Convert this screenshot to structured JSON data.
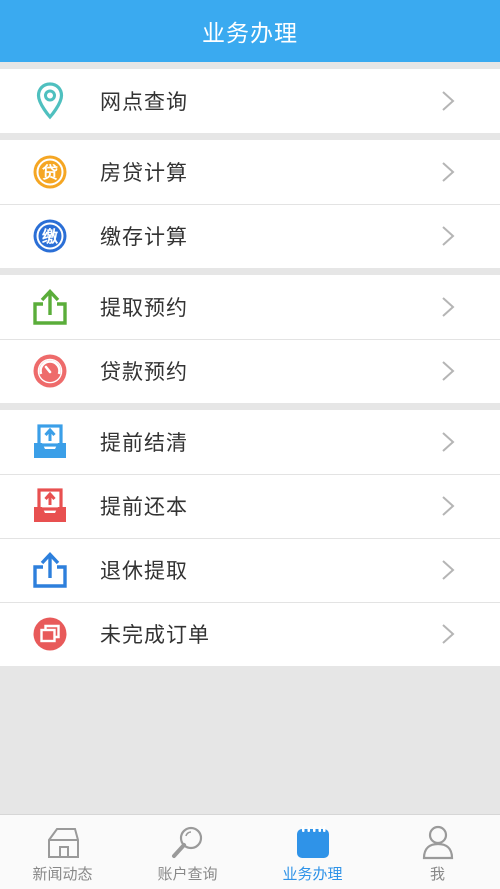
{
  "header": {
    "title": "业务办理"
  },
  "groups": [
    {
      "items": [
        {
          "label": "网点查询",
          "icon": "location-pin-icon",
          "color": "#4fc0bf"
        }
      ]
    },
    {
      "items": [
        {
          "label": "房贷计算",
          "icon": "loan-dai-icon",
          "color": "#f5a623",
          "glyph": "贷"
        },
        {
          "label": "缴存计算",
          "icon": "deposit-jiao-icon",
          "color": "#2b6fd6",
          "glyph": "缴"
        }
      ]
    },
    {
      "items": [
        {
          "label": "提取预约",
          "icon": "upload-share-icon",
          "color": "#5aad3a"
        },
        {
          "label": "贷款预约",
          "icon": "gauge-icon",
          "color": "#ee6b6b"
        }
      ]
    },
    {
      "items": [
        {
          "label": "提前结清",
          "icon": "tray-upload-icon",
          "color": "#3b9fe8"
        },
        {
          "label": "提前还本",
          "icon": "tray-upload-red-icon",
          "color": "#e85050"
        },
        {
          "label": "退休提取",
          "icon": "upload-share-blue-icon",
          "color": "#2d7fdc"
        },
        {
          "label": "未完成订单",
          "icon": "window-stack-icon",
          "color": "#e85a5a"
        }
      ]
    }
  ],
  "tabbar": {
    "tabs": [
      {
        "label": "新闻动态",
        "icon": "house-icon",
        "active": false
      },
      {
        "label": "账户查询",
        "icon": "magnifier-icon",
        "active": false
      },
      {
        "label": "业务办理",
        "icon": "calendar-icon",
        "active": true
      },
      {
        "label": "我",
        "icon": "person-icon",
        "active": false
      }
    ]
  },
  "colors": {
    "header": "#3aaaf0",
    "active_tab": "#2f93e8",
    "inactive_tab": "#888888",
    "background": "#e6e6e6"
  }
}
